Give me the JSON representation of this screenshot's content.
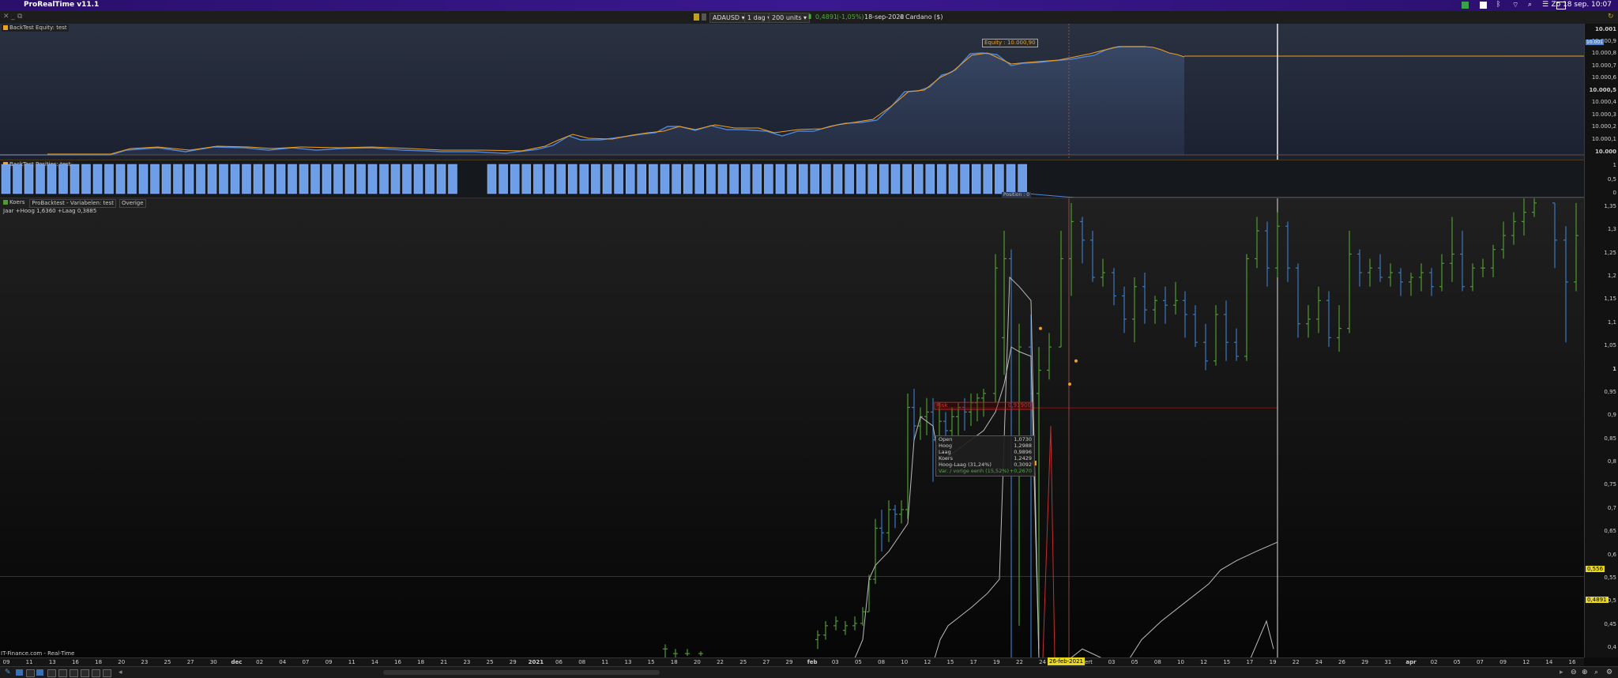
{
  "menubar": {
    "app_title": "ProRealTime v11.1",
    "clock": "Zo 18 sep. 10:07"
  },
  "toolbar": {
    "symbol": "ADAUSD",
    "timeframe": "1 dag",
    "units": "200 units",
    "last_price": "0,4891",
    "change": "(-1,05%)",
    "date": "18-sep-2022",
    "instrument": "Cardano ($)"
  },
  "colors": {
    "accent_orange": "#f0a020",
    "equity_line": "#4f86d8",
    "up_bar": "#4f9b2f",
    "down_bar": "#3b78c0",
    "red_level": "#a01818",
    "position_block": "#6f9ee8"
  },
  "equity": {
    "label": "BackTest Equity: test",
    "tag": "Equity : 10.000,90",
    "current_label": "10.001",
    "y_ticks": [
      "10.001",
      "10.000,9",
      "10.000,8",
      "10.000,7",
      "10.000,6",
      "10.000,5",
      "10.000,4",
      "10.000,3",
      "10.000,2",
      "10.000,1",
      "10.000"
    ]
  },
  "positions": {
    "label": "BackTest Posities: test",
    "y_ticks": [
      "1",
      "0,5",
      "0"
    ],
    "tag": "Position : 0"
  },
  "price": {
    "legend": [
      {
        "name": "Koers"
      },
      {
        "name": "ProBacktest - Variabelen: test"
      },
      {
        "name": "Overige"
      }
    ],
    "range_label": "Jaar +Hoog 1,6360 +Laag 0,3885",
    "risk_label": "Risk",
    "risk_value": "0,91900",
    "y_ticks": [
      "1,35",
      "1,3",
      "1,25",
      "1,2",
      "1,15",
      "1,1",
      "1,05",
      "1",
      "0,95",
      "0,9",
      "0,85",
      "0,8",
      "0,75",
      "0,7",
      "0,65",
      "0,6",
      "0,55",
      "0,5",
      "0,45",
      "0,4"
    ],
    "tag_level": "0,556",
    "tag_last": "0,4891"
  },
  "tooltip": [
    {
      "k": "Open",
      "v": "1,0730"
    },
    {
      "k": "Hoog",
      "v": "1,2988"
    },
    {
      "k": "Laag",
      "v": "0,9896"
    },
    {
      "k": "Koers",
      "v": "1,2429"
    },
    {
      "k": "Hoog-Laag (31,24%)",
      "v": "0,3092"
    },
    {
      "k": "Var. / vorige eenh (15,52%)",
      "v": "+0,2670"
    }
  ],
  "x_axis": {
    "ticks": [
      "09",
      "11",
      "13",
      "16",
      "18",
      "20",
      "23",
      "25",
      "27",
      "30",
      "dec",
      "02",
      "04",
      "07",
      "09",
      "11",
      "14",
      "16",
      "18",
      "21",
      "23",
      "25",
      "29",
      "2021",
      "06",
      "08",
      "11",
      "13",
      "15",
      "18",
      "20",
      "22",
      "25",
      "27",
      "29",
      "feb",
      "03",
      "05",
      "08",
      "10",
      "12",
      "15",
      "17",
      "19",
      "22",
      "24",
      "26-feb-2021",
      "ert",
      "03",
      "05",
      "08",
      "10",
      "12",
      "15",
      "17",
      "19",
      "22",
      "24",
      "26",
      "29",
      "31",
      "apr",
      "02",
      "05",
      "07",
      "09",
      "12",
      "14",
      "16"
    ],
    "cursor_date": "26-feb-2021"
  },
  "footer": {
    "source": "IT-Finance.com - Real-Time"
  },
  "chart_data": {
    "type": "ohlc",
    "title": "ADAUSD",
    "ylim": [
      0.38,
      1.37
    ],
    "x_range": [
      "2020-11-09",
      "2021-04-16"
    ],
    "tooltip_bar": {
      "date": "2021-02-22",
      "open": 1.073,
      "high": 1.2988,
      "low": 0.9896,
      "close": 1.2429
    }
  }
}
